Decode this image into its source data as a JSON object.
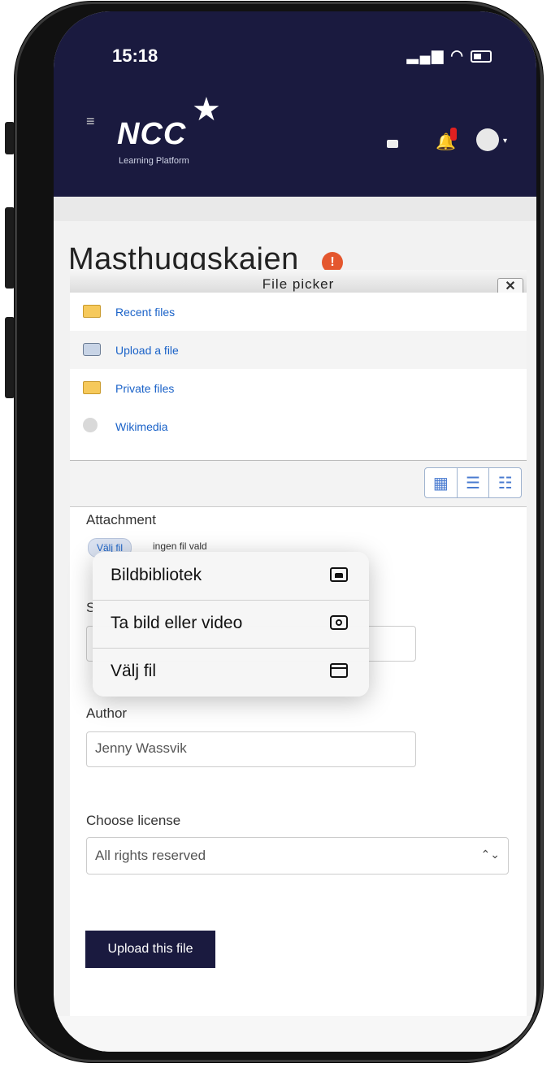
{
  "status": {
    "time": "15:18",
    "signal": "▂▄▆",
    "wifi": "◠"
  },
  "header": {
    "logo": "NCC",
    "logo_star": "★",
    "logo_sub": "Learning Platform",
    "menu_glyph": "≡",
    "bell_glyph": "🔔",
    "user_caret": "▾"
  },
  "page": {
    "title": "Masthuggskajen",
    "alert_glyph": "!"
  },
  "file_picker": {
    "title": "File picker",
    "close_glyph": "✕",
    "repositories": [
      {
        "label": "Recent files",
        "icon": "folder-icon"
      },
      {
        "label": "Upload a file",
        "icon": "upload-icon"
      },
      {
        "label": "Private files",
        "icon": "folder-icon"
      },
      {
        "label": "Wikimedia",
        "icon": "wikimedia-icon"
      }
    ],
    "view_icons": [
      "▦",
      "☰",
      "☷"
    ]
  },
  "form": {
    "attachment_label": "Attachment",
    "choose_button": "Välj fil",
    "no_file": "ingen fil vald",
    "save_as_label": "S",
    "author_label": "Author",
    "author_value": "Jenny Wassvik",
    "license_label": "Choose license",
    "license_value": "All rights reserved",
    "select_caret": "⌃⌄",
    "upload_button": "Upload this file"
  },
  "popover": {
    "items": [
      {
        "label": "Bildbibliotek",
        "icon": "photo-library-icon"
      },
      {
        "label": "Ta bild eller video",
        "icon": "camera-icon"
      },
      {
        "label": "Välj fil",
        "icon": "folder-icon"
      }
    ]
  },
  "colors": {
    "header_bg": "#1a1a3f",
    "link": "#1a62c8",
    "alert": "#e4572e",
    "button": "#1a1a3f"
  }
}
